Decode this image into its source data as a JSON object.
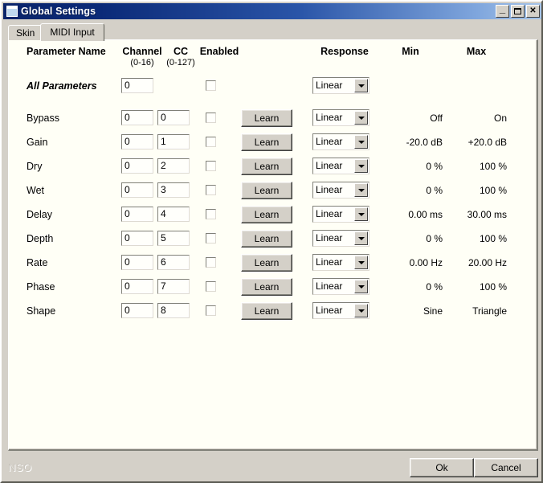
{
  "window": {
    "title": "Global Settings",
    "sys_icon": "window-icon",
    "buttons": {
      "minimize": "_",
      "maximize": "□",
      "close": "✕"
    }
  },
  "tabs": [
    {
      "label": "Skin",
      "active": false
    },
    {
      "label": "MIDI Input",
      "active": true
    }
  ],
  "table": {
    "headers": {
      "name": "Parameter Name",
      "channel": "Channel",
      "channel_sub": "(0-16)",
      "cc": "CC",
      "cc_sub": "(0-127)",
      "enabled": "Enabled",
      "response": "Response",
      "min": "Min",
      "max": "Max"
    },
    "all_row": {
      "label": "All Parameters",
      "channel": "0",
      "enabled": false,
      "response": "Linear"
    },
    "rows": [
      {
        "label": "Bypass",
        "channel": "0",
        "cc": "0",
        "enabled": false,
        "learn": "Learn",
        "response": "Linear",
        "min": "Off",
        "max": "On"
      },
      {
        "label": "Gain",
        "channel": "0",
        "cc": "1",
        "enabled": false,
        "learn": "Learn",
        "response": "Linear",
        "min": "-20.0 dB",
        "max": "+20.0 dB"
      },
      {
        "label": "Dry",
        "channel": "0",
        "cc": "2",
        "enabled": false,
        "learn": "Learn",
        "response": "Linear",
        "min": "0 %",
        "max": "100 %"
      },
      {
        "label": "Wet",
        "channel": "0",
        "cc": "3",
        "enabled": false,
        "learn": "Learn",
        "response": "Linear",
        "min": "0 %",
        "max": "100 %"
      },
      {
        "label": "Delay",
        "channel": "0",
        "cc": "4",
        "enabled": false,
        "learn": "Learn",
        "response": "Linear",
        "min": "0.00 ms",
        "max": "30.00 ms"
      },
      {
        "label": "Depth",
        "channel": "0",
        "cc": "5",
        "enabled": false,
        "learn": "Learn",
        "response": "Linear",
        "min": "0 %",
        "max": "100 %"
      },
      {
        "label": "Rate",
        "channel": "0",
        "cc": "6",
        "enabled": false,
        "learn": "Learn",
        "response": "Linear",
        "min": "0.00 Hz",
        "max": "20.00 Hz"
      },
      {
        "label": "Phase",
        "channel": "0",
        "cc": "7",
        "enabled": false,
        "learn": "Learn",
        "response": "Linear",
        "min": "0 %",
        "max": "100 %"
      },
      {
        "label": "Shape",
        "channel": "0",
        "cc": "8",
        "enabled": false,
        "learn": "Learn",
        "response": "Linear",
        "min": "Sine",
        "max": "Triangle"
      }
    ]
  },
  "footer": {
    "watermark": "NSO",
    "ok": "Ok",
    "cancel": "Cancel"
  },
  "colors": {
    "titlebar_start": "#0a246a",
    "titlebar_end": "#a6c4e8",
    "face": "#d4d0c8",
    "panel": "#fffff6"
  }
}
